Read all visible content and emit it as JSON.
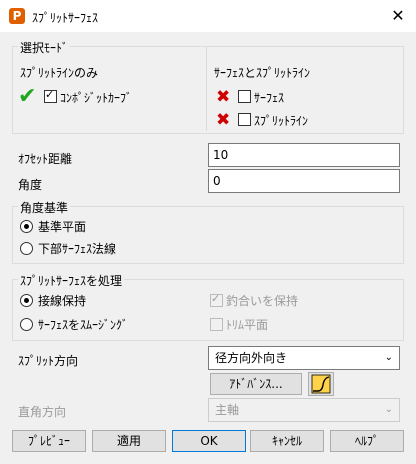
{
  "window": {
    "title": "ｽﾌﾟﾘｯﾄｻｰﾌｪｽ",
    "app_icon_letter": "P",
    "close_label": "✕"
  },
  "selection_mode": {
    "label": "選択ﾓｰﾄﾞ",
    "split_line_only": {
      "label": "ｽﾌﾟﾘｯﾄﾗｲﾝのみ",
      "composite_curve": "ｺﾝﾎﾟｼﾞｯﾄｶｰﾌﾞ",
      "composite_checked": true
    },
    "surface_and_split": {
      "label": "ｻｰﾌｪｽとｽﾌﾟﾘｯﾄﾗｲﾝ",
      "surface": "ｻｰﾌｪｽ",
      "split_line": "ｽﾌﾟﾘｯﾄﾗｲﾝ"
    }
  },
  "offset": {
    "label": "ｵﾌｾｯﾄ距離",
    "value": "10"
  },
  "angle": {
    "label": "角度",
    "value": "0"
  },
  "angle_reference": {
    "label": "角度基準",
    "options": [
      "基準平面",
      "下部ｻｰﾌｪｽ法線"
    ],
    "selected": 0
  },
  "process": {
    "label": "ｽﾌﾟﾘｯﾄｻｰﾌｪｽを処理",
    "options": [
      "接線保持",
      "ｻｰﾌｪｽをｽﾑｰｼﾞﾝｸﾞ"
    ],
    "selected": 0,
    "keep_balance": "釣合いを保持",
    "trim_plane": "ﾄﾘﾑ平面"
  },
  "split_direction": {
    "label": "ｽﾌﾟﾘｯﾄ方向",
    "value": "径方向外向き",
    "advanced": "ｱﾄﾞﾊﾞﾝｽ..."
  },
  "orthogonal_direction": {
    "label": "直角方向",
    "value": "主軸"
  },
  "buttons": {
    "preview": "ﾌﾟﾚﾋﾞｭｰ",
    "apply": "適用",
    "ok": "OK",
    "cancel": "ｷｬﾝｾﾙ",
    "help": "ﾍﾙﾌﾟ"
  }
}
